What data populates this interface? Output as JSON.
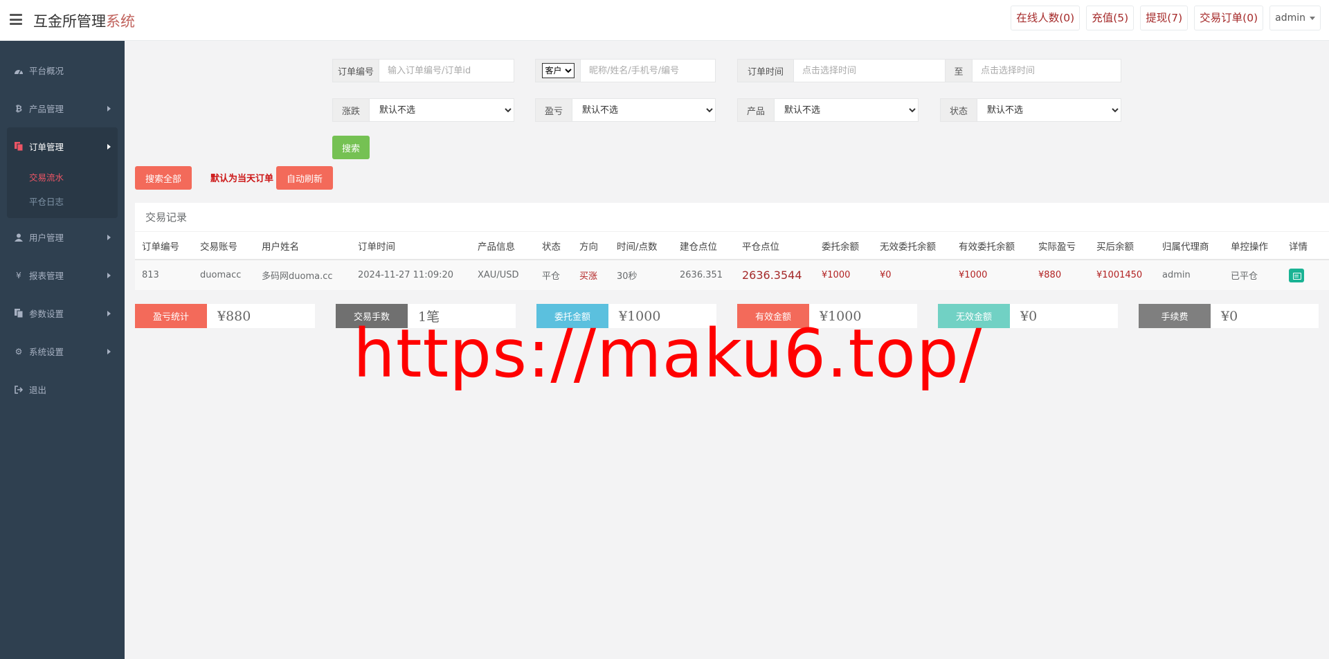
{
  "header": {
    "brand_main": "互金所管理",
    "brand_accent": "系统",
    "online": "在线人数(0)",
    "recharge": "充值(5)",
    "withdraw": "提现(7)",
    "orders": "交易订单(0)",
    "user": "admin"
  },
  "sidebar": {
    "items": [
      {
        "label": "平台概况",
        "icon": "dashboard-icon"
      },
      {
        "label": "产品管理",
        "icon": "bitcoin-icon"
      },
      {
        "label": "订单管理",
        "icon": "files-icon"
      },
      {
        "label": "用户管理",
        "icon": "user-icon"
      },
      {
        "label": "报表管理",
        "icon": "yen-icon"
      },
      {
        "label": "参数设置",
        "icon": "copy-icon"
      },
      {
        "label": "系统设置",
        "icon": "gears-icon"
      },
      {
        "label": "退出",
        "icon": "signout-icon"
      }
    ],
    "sub_items": [
      {
        "label": "交易流水",
        "active": true
      },
      {
        "label": "平仓日志",
        "active": false
      }
    ]
  },
  "filters": {
    "order_no_label": "订单编号",
    "order_no_placeholder": "输入订单编号/订单id",
    "customer_select": "客户",
    "customer_placeholder": "昵称/姓名/手机号/编号",
    "time_label": "订单时间",
    "time_start_placeholder": "点击选择时间",
    "time_to": "至",
    "time_end_placeholder": "点击选择时间",
    "rise_fall_label": "涨跌",
    "profit_label": "盈亏",
    "product_label": "产品",
    "status_label": "状态",
    "default_option": "默认不选",
    "search_button": "搜索"
  },
  "actions": {
    "search_all": "搜索全部",
    "default_hint": "默认为当天订单",
    "auto_refresh": "自动刷新"
  },
  "table": {
    "title": "交易记录",
    "headers": [
      "订单编号",
      "交易账号",
      "用户姓名",
      "订单时间",
      "产品信息",
      "状态",
      "方向",
      "时间/点数",
      "建仓点位",
      "平仓点位",
      "委托余额",
      "无效委托余额",
      "有效委托余额",
      "实际盈亏",
      "买后余额",
      "归属代理商",
      "单控操作",
      "详情"
    ],
    "rows": [
      {
        "order_no": "813",
        "account": "duomacc",
        "name": "多码网duoma.cc",
        "time": "2024-11-27 11:09:20",
        "product": "XAU/USD",
        "status": "平仓",
        "direction": "买涨",
        "duration": "30秒",
        "open_price": "2636.351",
        "close_price": "2636.3544",
        "entrusted": "¥1000",
        "invalid_entrusted": "¥0",
        "valid_entrusted": "¥1000",
        "actual_pnl": "¥880",
        "balance_after": "¥1001450",
        "agent": "admin",
        "control": "已平仓"
      }
    ]
  },
  "stats": [
    {
      "label": "盈亏统计",
      "value": "¥880",
      "color": "#f36a5a"
    },
    {
      "label": "交易手数",
      "value": "1笔",
      "color": "#707070"
    },
    {
      "label": "委托金额",
      "value": "¥1000",
      "color": "#5bc0de"
    },
    {
      "label": "有效金额",
      "value": "¥1000",
      "color": "#f36a5a"
    },
    {
      "label": "无效金额",
      "value": "¥0",
      "color": "#71d1c4"
    },
    {
      "label": "手续费",
      "value": "¥0",
      "color": "#7f7f7f"
    }
  ],
  "watermark": "https://maku6.top/"
}
